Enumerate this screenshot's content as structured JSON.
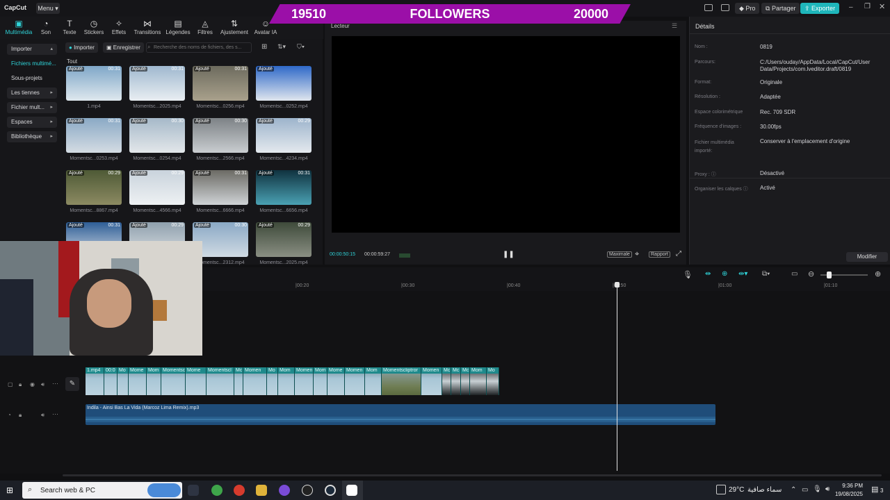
{
  "app": {
    "logo": "CapCut",
    "menu": "Menu"
  },
  "banner": {
    "left": "19510",
    "center": "FOLLOWERS",
    "right": "20000"
  },
  "topbar": {
    "pro": "Pro",
    "share": "Partager",
    "export": "Exporter"
  },
  "tools": [
    {
      "label": "Multimédia",
      "glyph": "▣"
    },
    {
      "label": "Son",
      "glyph": "◔"
    },
    {
      "label": "Texte",
      "glyph": "T"
    },
    {
      "label": "Stickers",
      "glyph": "◷"
    },
    {
      "label": "Effets",
      "glyph": "✧"
    },
    {
      "label": "Transitions",
      "glyph": "⋈"
    },
    {
      "label": "Légendes",
      "glyph": "▤"
    },
    {
      "label": "Filtres",
      "glyph": "◬"
    },
    {
      "label": "Ajustement",
      "glyph": "⇅"
    },
    {
      "label": "Avatar IA",
      "glyph": "☺"
    }
  ],
  "nav": [
    "Importer",
    "Fichiers multimé...",
    "Sous-projets",
    "Les tiennes",
    "Fichier mult...",
    "Espaces",
    "Bibliothèque"
  ],
  "media": {
    "import": "Importer",
    "record": "Enregistrer",
    "search_placeholder": "Recherche des noms de fichiers, des s...",
    "section": "Tout",
    "tag": "Ajouté",
    "items": [
      {
        "name": "1.mp4",
        "dur": "00:31"
      },
      {
        "name": "Momentsc...2025.mp4",
        "dur": "00:31"
      },
      {
        "name": "Momentsc...0256.mp4",
        "dur": "00:31"
      },
      {
        "name": "Momentsc...0252.mp4",
        "dur": ""
      },
      {
        "name": "Momentsc...0253.mp4",
        "dur": "00:31"
      },
      {
        "name": "Momentsc...0254.mp4",
        "dur": "00:30"
      },
      {
        "name": "Momentsc...2566.mp4",
        "dur": "00:30"
      },
      {
        "name": "Momentsc...4234.mp4",
        "dur": "00:29"
      },
      {
        "name": "Momentsc...8867.mp4",
        "dur": "00:29"
      },
      {
        "name": "Momentsc...4566.mp4",
        "dur": "00:29"
      },
      {
        "name": "Momentsc...6666.mp4",
        "dur": "00:31"
      },
      {
        "name": "Momentsc...6656.mp4",
        "dur": "00:31"
      },
      {
        "name": "",
        "dur": "00:31"
      },
      {
        "name": "",
        "dur": "00:29"
      },
      {
        "name": "Momentsc...2312.mp4",
        "dur": "00:30"
      },
      {
        "name": "Momentsc...2025.mp4",
        "dur": "00:29"
      }
    ]
  },
  "player": {
    "title": "Lecteur",
    "current": "00:00:50:15",
    "total": "00:00:59:27",
    "btn_max": "Maximale",
    "btn_ratio": "Rapport"
  },
  "details": {
    "title": "Détails",
    "rows": [
      {
        "k": "Nom :",
        "v": "0819"
      },
      {
        "k": "Parcours:",
        "v": "C:/Users/ouday/AppData/Local/CapCut/User Data/Projects/com.lveditor.draft/0819"
      },
      {
        "k": "Format:",
        "v": "Originale"
      },
      {
        "k": "Résolution :",
        "v": "Adaptée"
      },
      {
        "k": "Espace colorimétrique",
        "v": "Rec. 709 SDR"
      },
      {
        "k": "Fréquence d'images :",
        "v": "30.00fps"
      },
      {
        "k": "Fichier multimédia importé:",
        "v": "Conserver à l'emplacement d'origine"
      },
      {
        "k": "Proxy : ⓘ",
        "v": "Désactivé"
      },
      {
        "k": "Organiser les calques ⓘ",
        "v": "Activé"
      }
    ],
    "modify": "Modifier"
  },
  "ruler": [
    "|00:20",
    "|00:30",
    "|00:40",
    "|00:50",
    "|01:00",
    "|01:10"
  ],
  "clips": [
    "1.mp4",
    "00:0",
    "Mo",
    "Mome",
    "Mom",
    "Momentsc",
    "Mome",
    "Momentscl",
    "Mc",
    "Momen",
    "Mo",
    "Mom",
    "Momen",
    "Mom",
    "Mome",
    "Momen",
    "Mom",
    "Momentscliptror",
    "Momen",
    "Mc",
    "Mc",
    "Mc",
    "Mom",
    "Mo"
  ],
  "audio": {
    "name": "Indila - Ainsi Bas La Vida (Marcoz Lima Remix).mp3"
  },
  "taskbar": {
    "search": "Search web & PC",
    "weather": "29°C",
    "weather_text": "سماء صافية",
    "time": "9:36 PM",
    "date": "19/08/2025",
    "notif": "3"
  },
  "colors": {
    "accent": "#2fd3d8",
    "banner": "#9b0fa8",
    "clip": "#1f8a8c",
    "audio": "#1f4d7a"
  }
}
